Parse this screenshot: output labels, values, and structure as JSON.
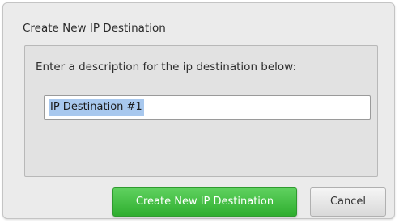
{
  "dialog": {
    "title": "Create New IP Destination",
    "prompt": "Enter a description for the ip destination below:",
    "input_value": "IP Destination #1",
    "primary_button": "Create New IP Destination",
    "cancel_button": "Cancel"
  },
  "colors": {
    "primary_button": "#3cba3c",
    "dialog_background": "#ebebeb",
    "selection_highlight": "#a8c8ee"
  }
}
